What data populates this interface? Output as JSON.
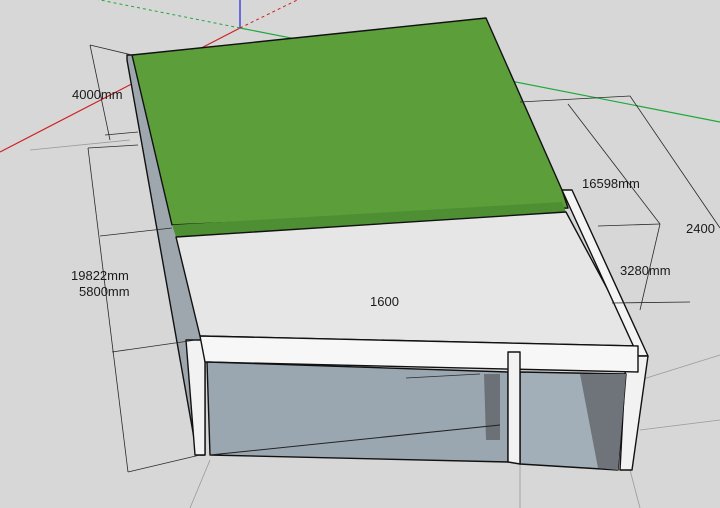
{
  "scene": {
    "grass_color": "#5b9e3a",
    "grass_dark": "#4f8f33",
    "slab_color": "#e6e6e6",
    "glass_color": "#9aa7b1",
    "axis_red": "#d02020",
    "axis_green": "#1fa83a",
    "axis_blue": "#2222dd"
  },
  "dimensions": {
    "top_left_depth": "4000mm",
    "left_length": "19822mm",
    "left_height": "5800mm",
    "right_length": "16598mm",
    "right_inset": "3280mm",
    "right_edge_partial": "2400",
    "center_partial": "1600"
  }
}
